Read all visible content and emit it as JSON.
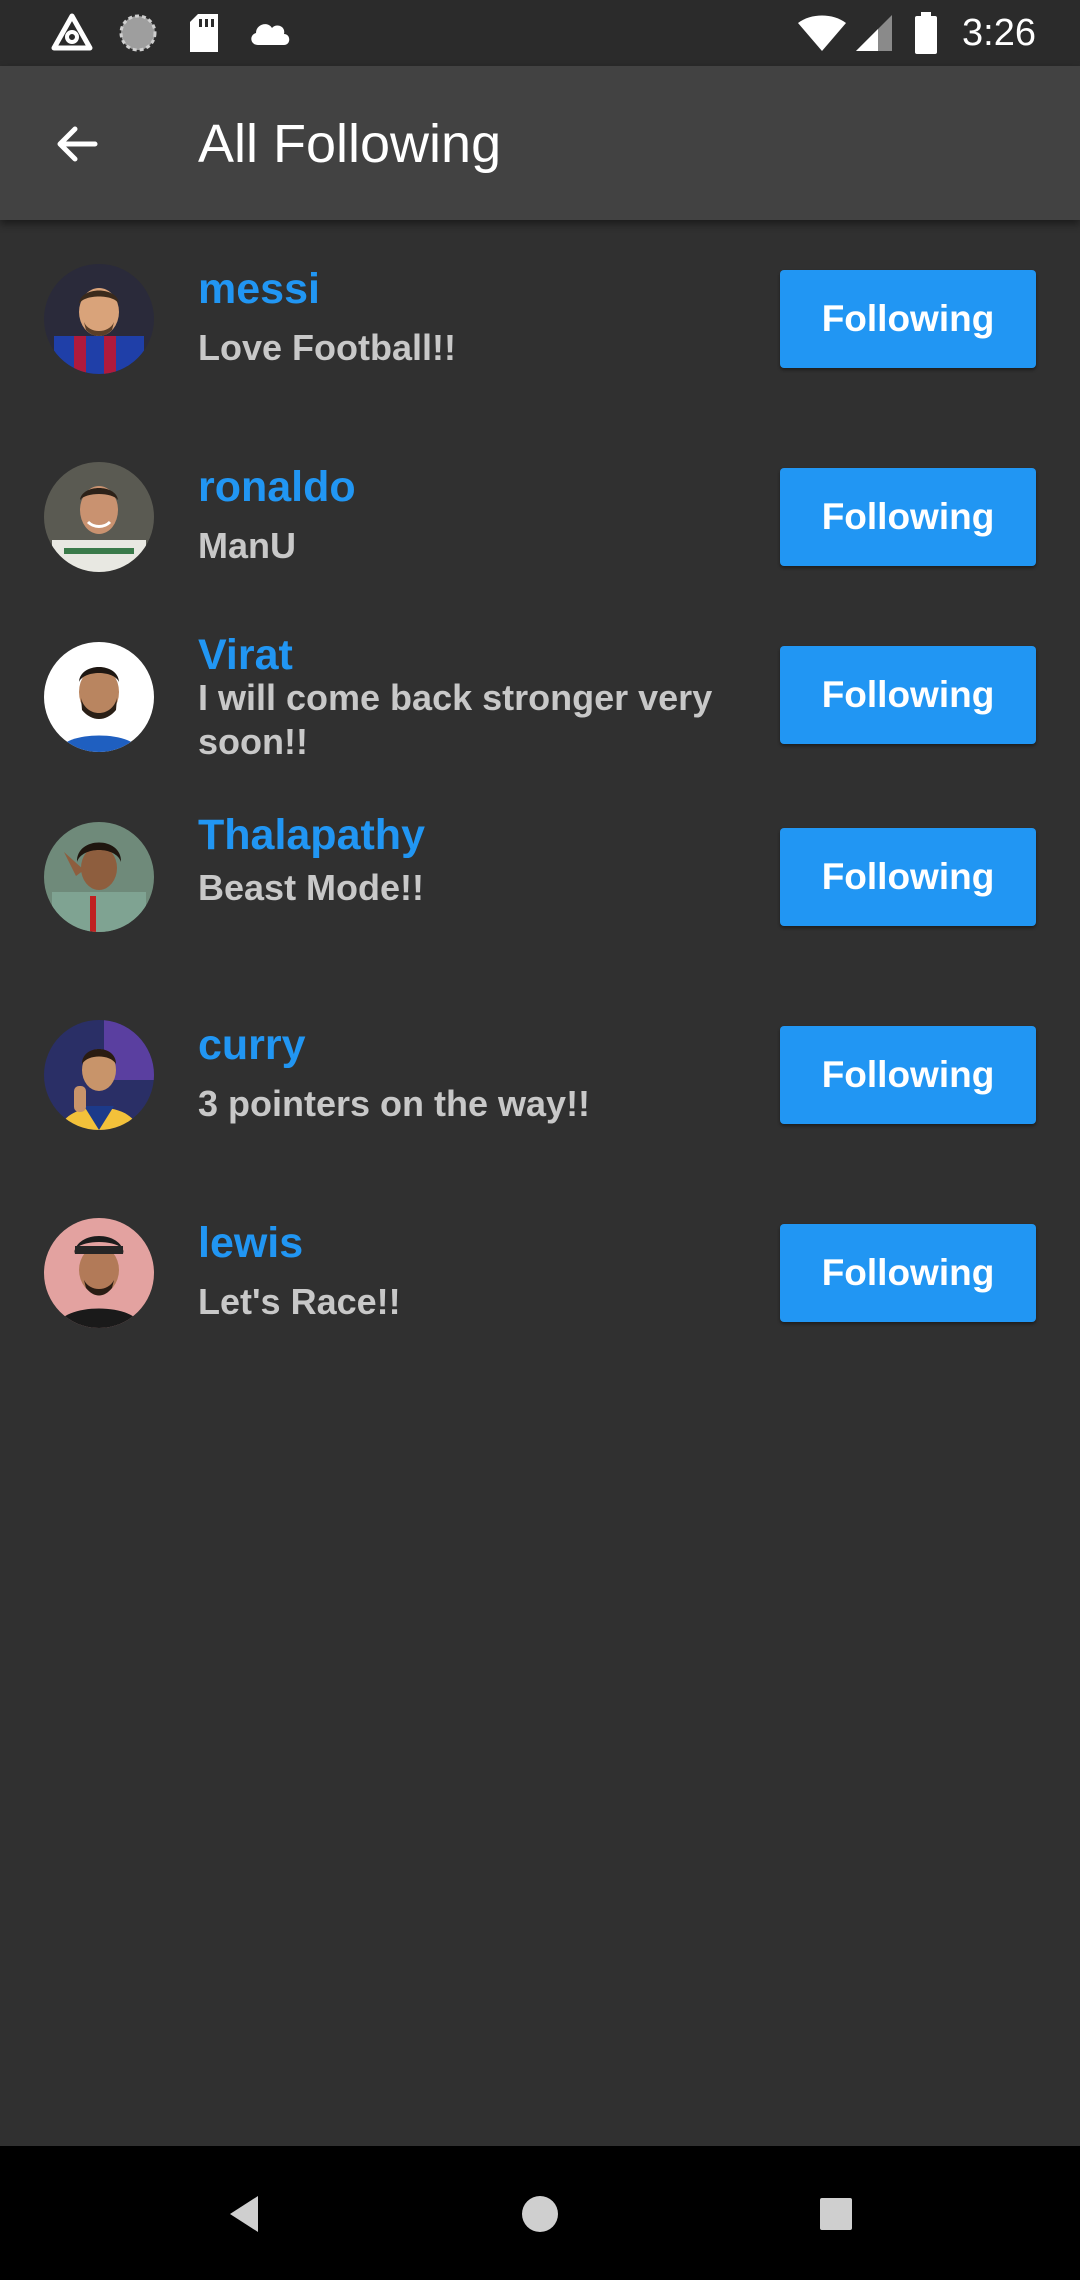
{
  "status_bar": {
    "time": "3:26",
    "left_icons": [
      "android-auto-icon",
      "sync-circle-icon",
      "sd-card-icon",
      "cloud-icon"
    ],
    "right_icons": [
      "wifi-icon",
      "cell-signal-icon",
      "battery-icon"
    ]
  },
  "app_bar": {
    "back_icon": "arrow-back-icon",
    "title": "All Following"
  },
  "following": [
    {
      "name": "messi",
      "bio": "Love Football!!",
      "button": "Following",
      "avatar": "avatar-messi"
    },
    {
      "name": "ronaldo",
      "bio": "ManU",
      "button": "Following",
      "avatar": "avatar-ronaldo"
    },
    {
      "name": "Virat",
      "bio": "I will come back stronger very soon!!",
      "button": "Following",
      "avatar": "avatar-virat"
    },
    {
      "name": "Thalapathy",
      "bio": "Beast Mode!!",
      "button": "Following",
      "avatar": "avatar-thalapathy"
    },
    {
      "name": "curry",
      "bio": "3 pointers on the way!!",
      "button": "Following",
      "avatar": "avatar-curry"
    },
    {
      "name": "lewis",
      "bio": "Let's Race!!",
      "button": "Following",
      "avatar": "avatar-lewis"
    }
  ],
  "nav_bar": {
    "icons": [
      "nav-back-icon",
      "nav-home-icon",
      "nav-recents-icon"
    ]
  },
  "colors": {
    "background": "#303030",
    "app_bar": "#424242",
    "accent": "#2196f3",
    "bio_text": "#c8c8c8"
  }
}
